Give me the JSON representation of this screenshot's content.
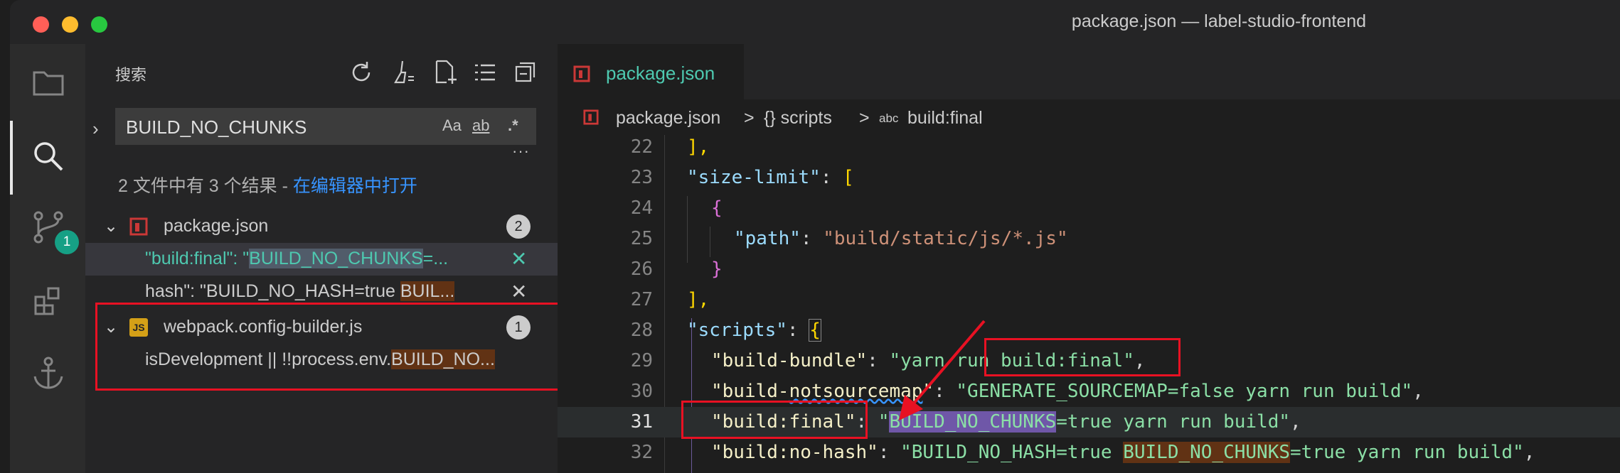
{
  "window": {
    "title": "package.json — label-studio-frontend"
  },
  "activity_bar": {
    "scm_badge": "1"
  },
  "sidebar": {
    "title": "搜索",
    "search": {
      "value": "BUILD_NO_CHUNKS",
      "opt_case": "Aa",
      "opt_word": "ab",
      "opt_regex": ".*"
    },
    "more": "···",
    "summary": "2 文件中有 3 个结果 - ",
    "open_in_editor": "在编辑器中打开",
    "results": [
      {
        "file": "package.json",
        "count": "2",
        "matches": [
          {
            "before": "\"build:final\": \"",
            "match": "BUILD_NO_CHUNKS",
            "after": "=..."
          },
          {
            "before": "hash\": \"BUILD_NO_HASH=true ",
            "match": "BUIL...",
            "after": ""
          }
        ]
      },
      {
        "file": "webpack.config-builder.js",
        "icon_text": "JS",
        "count": "1",
        "matches": [
          {
            "before": "isDevelopment || !!process.env.",
            "match": "BUILD_NO...",
            "after": ""
          }
        ]
      }
    ]
  },
  "editor": {
    "tab": "package.json",
    "breadcrumbs": [
      "package.json",
      ">",
      "{} scripts",
      ">",
      "abc",
      "build:final"
    ],
    "lines": [
      {
        "n": "22"
      },
      {
        "n": "23"
      },
      {
        "n": "24"
      },
      {
        "n": "25"
      },
      {
        "n": "26"
      },
      {
        "n": "27"
      },
      {
        "n": "28"
      },
      {
        "n": "29"
      },
      {
        "n": "30"
      },
      {
        "n": "31"
      },
      {
        "n": "32"
      }
    ],
    "text": {
      "l22": "],",
      "l23_key": "\"size-limit\"",
      "l23_rest": ": ",
      "l23_br": "[",
      "l24": "{",
      "l25_key": "\"path\"",
      "l25_rest": ": ",
      "l25_val": "\"build/static/js/*.js\"",
      "l26": "}",
      "l27": "],",
      "l28_key": "\"scripts\"",
      "l28_rest": ": ",
      "l28_br": "{",
      "l29_key": "\"build-bundle\"",
      "l29_rest": ": ",
      "l29_val": "\"yarn run build:final\"",
      "l29_end": ",",
      "l30_key_a": "\"build-",
      "l30_key_b": "notsourcemap",
      "l30_key_c": "\"",
      "l30_rest": ": ",
      "l30_val": "\"GENERATE_SOURCEMAP=false yarn run build\"",
      "l30_end": ",",
      "l31_key": "\"build:final\"",
      "l31_rest": ": ",
      "l31_q": "\"",
      "l31_match": "BUILD_NO_CHUNKS",
      "l31_val": "=true yarn run build\"",
      "l31_end": ",",
      "l32_key": "\"build:no-hash\"",
      "l32_rest": ": ",
      "l32_val_a": "\"BUILD_NO_HASH=true ",
      "l32_match": "BUILD_NO_CHUNKS",
      "l32_val_b": "=true yarn run build\"",
      "l32_end": ","
    }
  },
  "colors": {
    "annotation": "#e81123",
    "accent": "#4ec9b0",
    "link": "#3794ff"
  }
}
